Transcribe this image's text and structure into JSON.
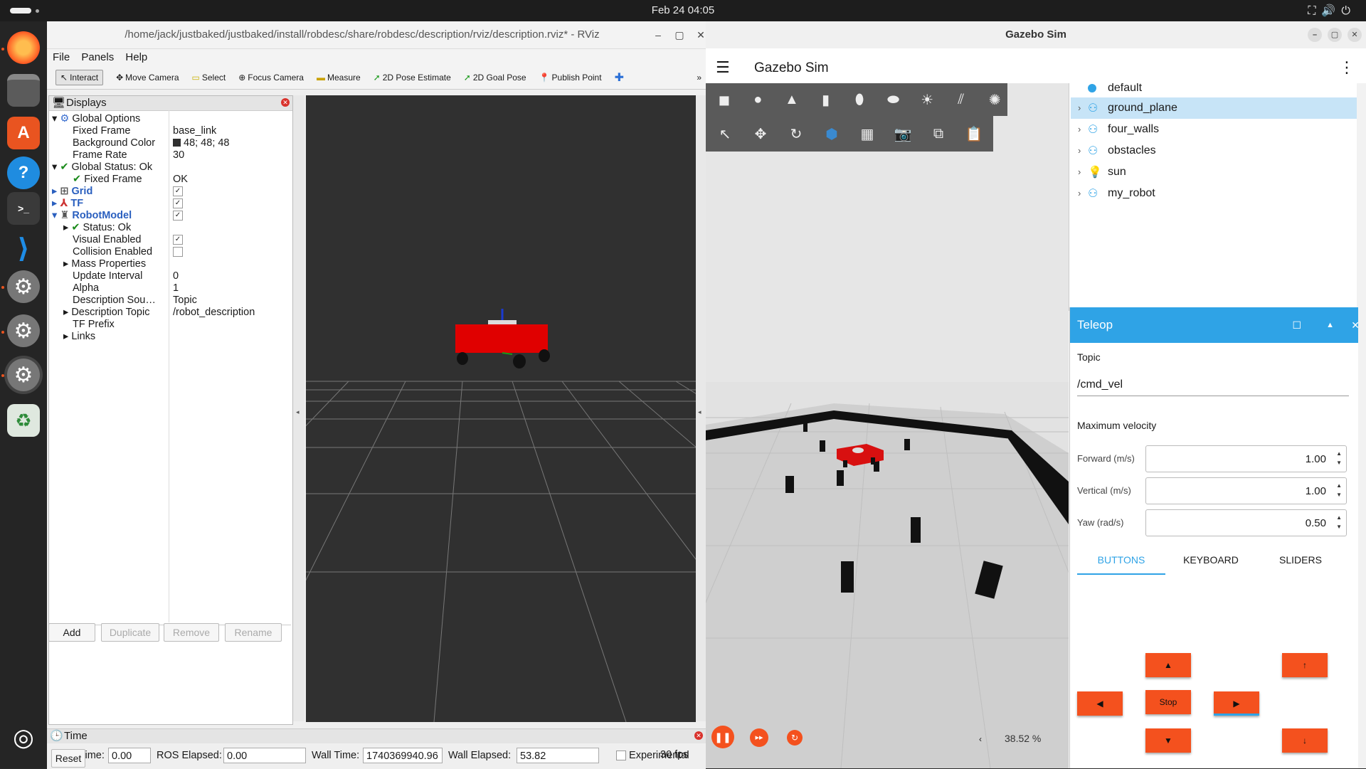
{
  "system": {
    "clock": "Feb 24  04:05"
  },
  "dock": {
    "items": [
      "firefox-icon",
      "files-icon",
      "app-center-icon",
      "help-icon",
      "terminal-icon",
      "vscode-icon",
      "settings-icon",
      "settings-icon",
      "settings-icon",
      "trash-icon",
      "ubuntu-logo"
    ]
  },
  "rviz": {
    "title": "/home/jack/justbaked/justbaked/install/robdesc/share/robdesc/description/rviz/description.rviz* - RViz",
    "menu": {
      "file": "File",
      "panels": "Panels",
      "help": "Help"
    },
    "tools": {
      "interact": "Interact",
      "move_camera": "Move Camera",
      "select": "Select",
      "focus_camera": "Focus Camera",
      "measure": "Measure",
      "pose_estimate": "2D Pose Estimate",
      "goal_pose": "2D Goal Pose",
      "publish_point": "Publish Point"
    },
    "displays": {
      "title": "Displays",
      "global_options": "Global Options",
      "fixed_frame_label": "Fixed Frame",
      "fixed_frame_value": "base_link",
      "bg_color_label": "Background Color",
      "bg_color_value": "48; 48; 48",
      "frame_rate_label": "Frame Rate",
      "frame_rate_value": "30",
      "global_status_label": "Global Status: Ok",
      "fixed_frame_status_label": "Fixed Frame",
      "fixed_frame_status_value": "OK",
      "grid_label": "Grid",
      "tf_label": "TF",
      "robotmodel_label": "RobotModel",
      "status_label": "Status: Ok",
      "visual_enabled_label": "Visual Enabled",
      "collision_enabled_label": "Collision Enabled",
      "mass_properties_label": "Mass Properties",
      "update_interval_label": "Update Interval",
      "update_interval_value": "0",
      "alpha_label": "Alpha",
      "alpha_value": "1",
      "description_source_label": "Description Sou…",
      "description_source_value": "Topic",
      "description_topic_label": "Description Topic",
      "description_topic_value": "/robot_description",
      "tf_prefix_label": "TF Prefix",
      "links_label": "Links",
      "buttons": {
        "add": "Add",
        "duplicate": "Duplicate",
        "remove": "Remove",
        "rename": "Rename"
      }
    },
    "time": {
      "title": "Time",
      "ros_time_label": "ROS Time:",
      "ros_time_value": "0.00",
      "ros_elapsed_label": "ROS Elapsed:",
      "ros_elapsed_value": "0.00",
      "wall_time_label": "Wall Time:",
      "wall_time_value": "1740369940.96",
      "wall_elapsed_label": "Wall Elapsed:",
      "wall_elapsed_value": "53.82",
      "experimental_label": "Experimental",
      "reset_label": "Reset",
      "fps": "30 fps"
    },
    "colors": {
      "background": "#303030",
      "robot": "#e00000"
    }
  },
  "gazebo": {
    "window_title": "Gazebo Sim",
    "app_title": "Gazebo Sim",
    "entity_tree": {
      "partial_top": "default",
      "items": [
        "ground_plane",
        "four_walls",
        "obstacles",
        "sun",
        "my_robot"
      ],
      "selected": "ground_plane"
    },
    "teleop": {
      "title": "Teleop",
      "topic_label": "Topic",
      "topic_value": "/cmd_vel",
      "max_velocity_label": "Maximum velocity",
      "forward_label": "Forward (m/s)",
      "forward_value": "1.00",
      "vertical_label": "Vertical (m/s)",
      "vertical_value": "1.00",
      "yaw_label": "Yaw (rad/s)",
      "yaw_value": "0.50",
      "tabs": [
        "BUTTONS",
        "KEYBOARD",
        "SLIDERS"
      ],
      "active_tab": "BUTTONS",
      "stop_label": "Stop"
    },
    "rtf": "38.52 %",
    "colors": {
      "accent": "#2fa3e6",
      "button": "#f4511e",
      "selected_row": "#c7e4f7"
    }
  }
}
